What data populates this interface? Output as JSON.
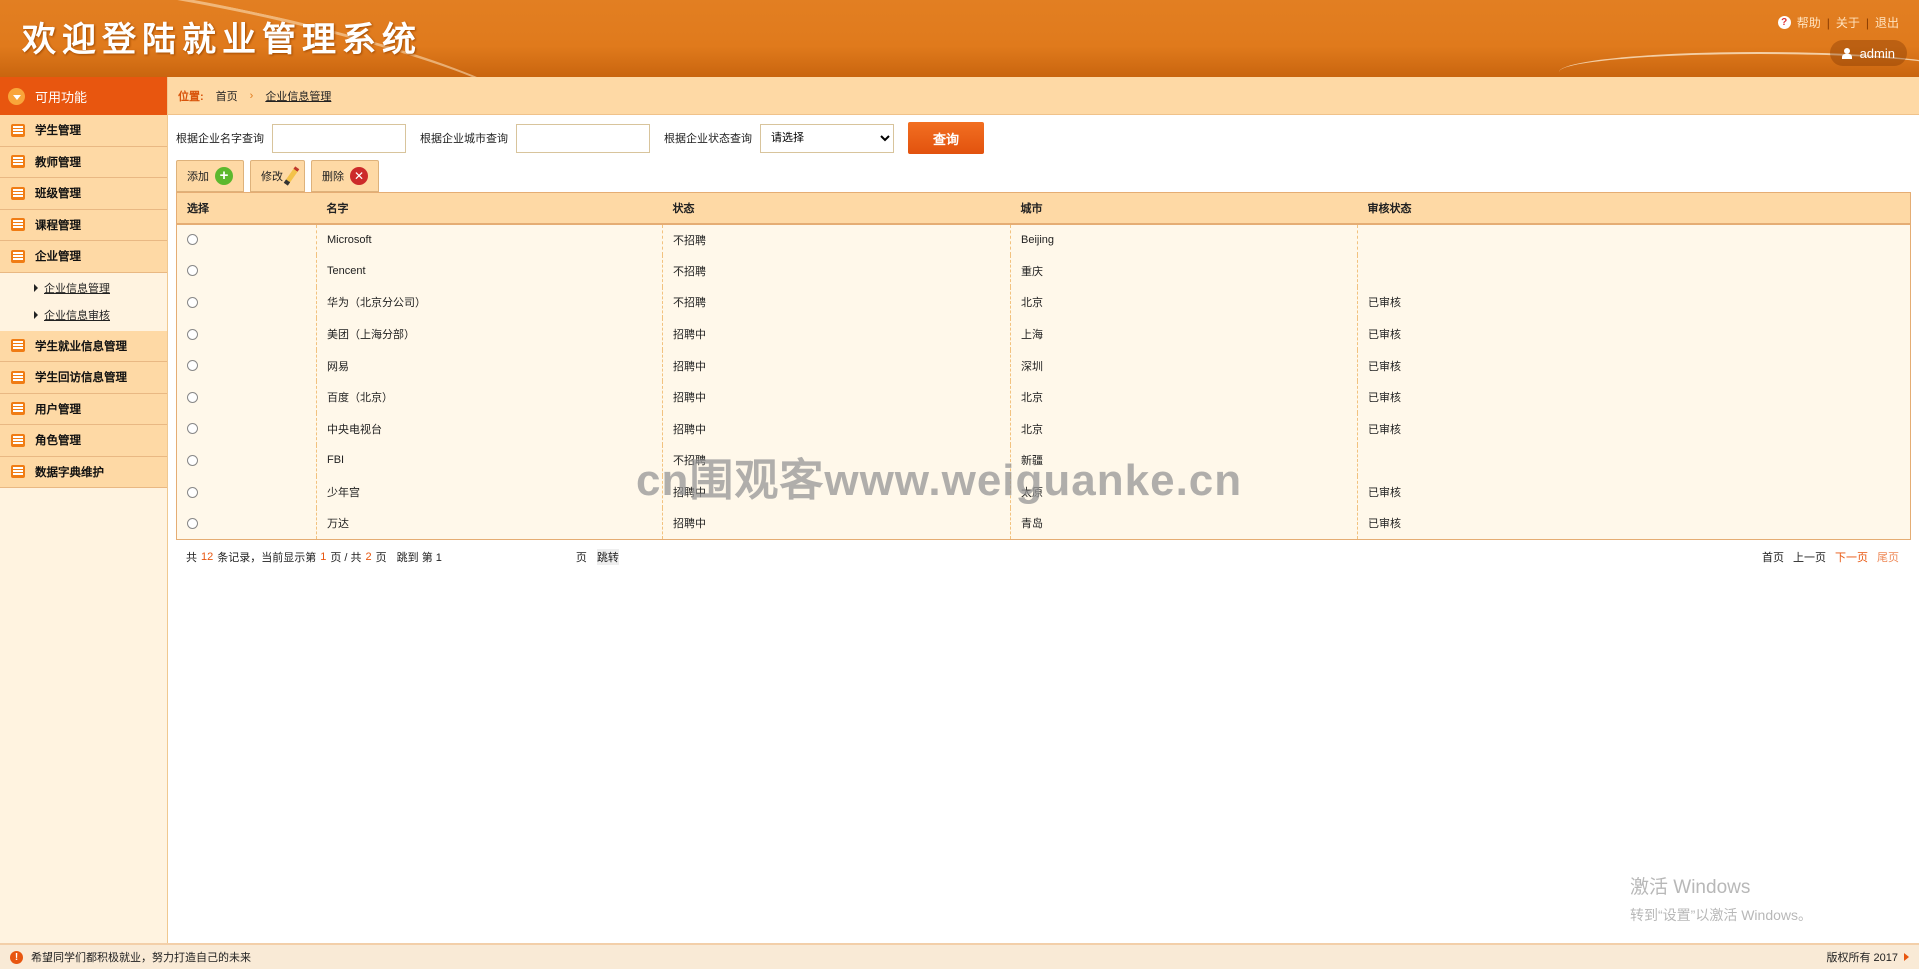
{
  "header": {
    "title": "欢迎登陆就业管理系统",
    "help": "帮助",
    "about": "关于",
    "logout": "退出",
    "user": "admin"
  },
  "sidebar": {
    "title": "可用功能",
    "items": [
      {
        "label": "学生管理"
      },
      {
        "label": "教师管理"
      },
      {
        "label": "班级管理"
      },
      {
        "label": "课程管理"
      },
      {
        "label": "企业管理"
      }
    ],
    "sub_items": [
      {
        "label": "企业信息管理"
      },
      {
        "label": "企业信息审核"
      }
    ],
    "items2": [
      {
        "label": "学生就业信息管理"
      },
      {
        "label": "学生回访信息管理"
      },
      {
        "label": "用户管理"
      },
      {
        "label": "角色管理"
      },
      {
        "label": "数据字典维护"
      }
    ]
  },
  "breadcrumb": {
    "label": "位置:",
    "home": "首页",
    "current": "企业信息管理"
  },
  "search": {
    "name_label": "根据企业名字查询",
    "name_value": "",
    "city_label": "根据企业城市查询",
    "city_value": "",
    "status_label": "根据企业状态查询",
    "status_selected": "请选择",
    "query_label": "查询"
  },
  "actions": {
    "add": "添加",
    "edit": "修改",
    "delete": "删除"
  },
  "table": {
    "headers": [
      "选择",
      "名字",
      "状态",
      "城市",
      "审核状态"
    ],
    "rows": [
      {
        "name": "Microsoft",
        "status": "不招聘",
        "city": "Beijing",
        "audit": ""
      },
      {
        "name": "Tencent",
        "status": "不招聘",
        "city": "重庆",
        "audit": ""
      },
      {
        "name": "华为（北京分公司）",
        "status": "不招聘",
        "city": "北京",
        "audit": "已审核"
      },
      {
        "name": "美团（上海分部）",
        "status": "招聘中",
        "city": "上海",
        "audit": "已审核"
      },
      {
        "name": "网易",
        "status": "招聘中",
        "city": "深圳",
        "audit": "已审核"
      },
      {
        "name": "百度（北京）",
        "status": "招聘中",
        "city": "北京",
        "audit": "已审核"
      },
      {
        "name": "中央电视台",
        "status": "招聘中",
        "city": "北京",
        "audit": "已审核"
      },
      {
        "name": "FBI",
        "status": "不招聘",
        "city": "新疆",
        "audit": ""
      },
      {
        "name": "少年宫",
        "status": "招聘中",
        "city": "太原",
        "audit": "已审核"
      },
      {
        "name": "万达",
        "status": "招聘中",
        "city": "青岛",
        "audit": "已审核"
      }
    ]
  },
  "pager": {
    "t1": "共",
    "total": "12",
    "t2": "条记录，当前显示第",
    "page": "1",
    "t3": "页 / 共",
    "pages": "2",
    "t4": "页",
    "t5": "跳到 第 1",
    "t6": "页",
    "jump": "跳转",
    "first": "首页",
    "prev": "上一页",
    "next": "下一页",
    "last": "尾页"
  },
  "watermark": "cn围观客www.weiguanke.cn",
  "windows": {
    "line1": "激活 Windows",
    "line2": "转到“设置”以激活 Windows。"
  },
  "footer": {
    "message": "希望同学们都积极就业，努力打造自己的未来",
    "copyright": "版权所有 2017"
  }
}
